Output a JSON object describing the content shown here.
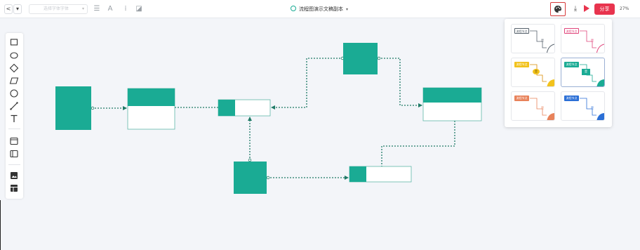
{
  "toolbar": {
    "back_label": "<",
    "font_select_value": "选择字体字体",
    "document_title": "流程图演示文稿副本",
    "share_label": "分享",
    "zoom_label": "27%"
  },
  "icons": {
    "theme": "palette-icon",
    "download": "download-icon",
    "play": "play-icon",
    "status": "saved-check-icon"
  },
  "colors": {
    "accent": "#1aab94",
    "share": "#e8344e",
    "connector": "#1f7a66"
  },
  "theme_panel": {
    "themes": [
      {
        "label": "流程节点",
        "mid": "是",
        "color": "#55606b",
        "fill": "#ffffff"
      },
      {
        "label": "流程节点",
        "mid": "是",
        "color": "#e0457b",
        "fill": "#ffffff"
      },
      {
        "label": "流程节点",
        "mid": "是",
        "color": "#f2b705",
        "fill": "#f2c21b"
      },
      {
        "label": "流程节点",
        "mid": "是",
        "color": "#1aab94",
        "fill": "#1aab94"
      },
      {
        "label": "流程节点",
        "mid": "是",
        "color": "#e8825a",
        "fill": "#e8825a"
      },
      {
        "label": "流程节点",
        "mid": "是",
        "color": "#2b6fd6",
        "fill": "#2b6fd6"
      }
    ]
  }
}
